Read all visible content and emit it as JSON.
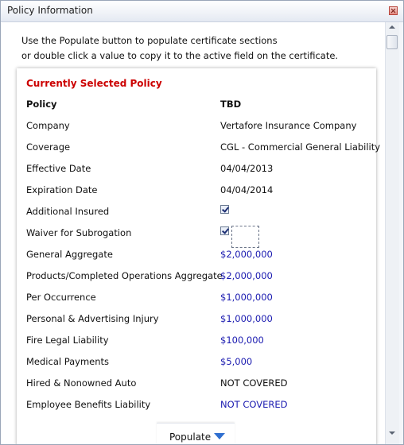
{
  "window": {
    "title": "Policy Information"
  },
  "instructions": {
    "line1": "Use the Populate button to populate certificate sections",
    "line2": "or double click a value to copy it to the active field on the certificate."
  },
  "section": {
    "heading": "Currently Selected Policy",
    "header_row": {
      "label": "Policy",
      "value": "TBD"
    },
    "rows": [
      {
        "label": "Company",
        "value": "Vertafore Insurance Company"
      },
      {
        "label": "Coverage",
        "value": "CGL - Commercial General Liability"
      },
      {
        "label": "Effective Date",
        "value": "04/04/2013"
      },
      {
        "label": "Expiration Date",
        "value": "04/04/2014"
      },
      {
        "label": "Additional Insured",
        "checked": true
      },
      {
        "label": "Waiver for Subrogation",
        "checked": true
      },
      {
        "label": "General Aggregate",
        "value": "$2,000,000"
      },
      {
        "label": "Products/Completed Operations Aggregate",
        "value": "$2,000,000"
      },
      {
        "label": "Per Occurrence",
        "value": "$1,000,000"
      },
      {
        "label": "Personal & Advertising Injury",
        "value": "$1,000,000"
      },
      {
        "label": "Fire Legal Liability",
        "value": "$100,000"
      },
      {
        "label": "Medical Payments",
        "value": "$5,000"
      },
      {
        "label": "Hired & Nonowned Auto",
        "value": "NOT COVERED"
      },
      {
        "label": "Employee Benefits Liability",
        "value": "NOT COVERED"
      }
    ]
  },
  "populate_button": {
    "label": "Populate"
  },
  "colors": {
    "heading": "#cc0000",
    "link_value": "#1a1ab0",
    "dropdown_arrow": "#2f6fd0"
  },
  "icons": {
    "close": "close-icon",
    "dropdown": "chevron-down-icon"
  }
}
